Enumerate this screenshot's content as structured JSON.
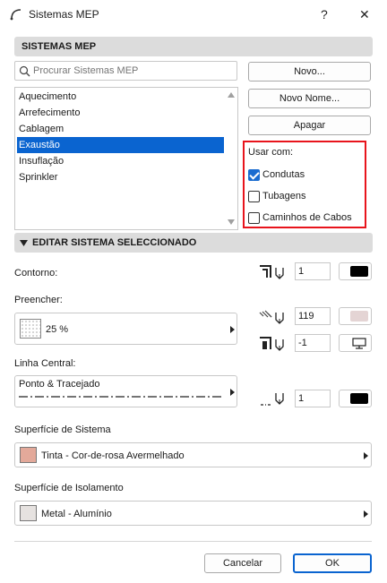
{
  "window": {
    "title": "Sistemas MEP",
    "help_label": "?",
    "close_label": "✕"
  },
  "section_main": {
    "title": "SISTEMAS MEP"
  },
  "search": {
    "placeholder": "Procurar Sistemas MEP",
    "value": ""
  },
  "systems": {
    "items": [
      "Aquecimento",
      "Arrefecimento",
      "Cablagem",
      "Exaustão",
      "Insuflação",
      "Sprinkler"
    ],
    "selected": "Exaustão"
  },
  "buttons": {
    "novo": "Novo...",
    "novo_nome": "Novo Nome...",
    "apagar": "Apagar"
  },
  "usar_com": {
    "label": "Usar com:",
    "options": [
      {
        "label": "Condutas",
        "checked": true
      },
      {
        "label": "Tubagens",
        "checked": false
      },
      {
        "label": "Caminhos de Cabos",
        "checked": false
      }
    ],
    "highlight_color": "#e8141c"
  },
  "section_edit": {
    "title": "EDITAR SISTEMA SELECCIONADO"
  },
  "contorno": {
    "label": "Contorno:",
    "pen_value": "1",
    "pen_color": "#000000"
  },
  "preencher": {
    "label": "Preencher:",
    "fill_value": "25 %",
    "pen_value": "119",
    "pen_color": "#e4d4d4",
    "bg_pen_value": "-1"
  },
  "linha_central": {
    "label": "Linha Central:",
    "line_type": "Ponto & Tracejado",
    "pen_value": "1",
    "pen_color": "#000000"
  },
  "superficie_sistema": {
    "label": "Superfície de Sistema",
    "value": "Tinta - Cor-de-rosa Avermelhado",
    "swatch_color": "#e3a99a"
  },
  "superficie_isolamento": {
    "label": "Superfície de Isolamento",
    "value": "Metal - Alumínio",
    "swatch_color": "#e6e2e0"
  },
  "footer": {
    "cancel_label": "Cancelar",
    "ok_label": "OK"
  }
}
